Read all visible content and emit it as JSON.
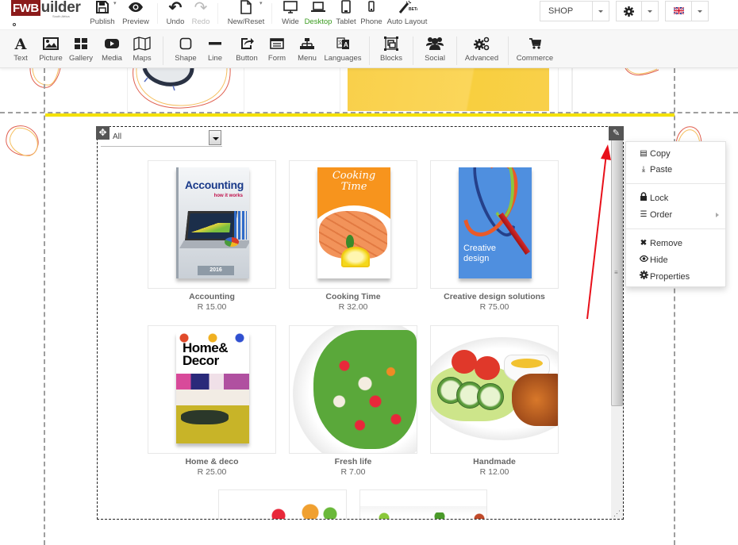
{
  "app": {
    "logo_brand": "FWB",
    "logo_rest": "uilder",
    "logo_sub": "South Africa"
  },
  "top_toolbar": {
    "buttons": [
      {
        "label": "Publish",
        "icon": "floppy-disk-icon"
      },
      {
        "label": "Preview",
        "icon": "eye-icon"
      },
      {
        "label": "Undo",
        "icon": "undo-icon"
      },
      {
        "label": "Redo",
        "icon": "redo-icon",
        "disabled": true
      },
      {
        "label": "New/Reset",
        "icon": "new-page-icon"
      },
      {
        "label": "Wide",
        "icon": "monitor-icon"
      },
      {
        "label": "Desktop",
        "icon": "laptop-icon",
        "active": true
      },
      {
        "label": "Tablet",
        "icon": "tablet-icon"
      },
      {
        "label": "Phone",
        "icon": "phone-icon"
      },
      {
        "label": "Auto Layout",
        "icon": "magic-wand-icon",
        "badge": "BETA"
      }
    ],
    "page_select": "SHOP",
    "settings_icon": "gear-icon",
    "language_icon": "uk-flag-icon"
  },
  "element_toolbar": {
    "items": [
      {
        "label": "Text",
        "icon": "text-icon"
      },
      {
        "label": "Picture",
        "icon": "picture-icon"
      },
      {
        "label": "Gallery",
        "icon": "gallery-icon"
      },
      {
        "label": "Media",
        "icon": "media-icon"
      },
      {
        "label": "Maps",
        "icon": "map-icon"
      },
      {
        "label": "Shape",
        "icon": "shape-icon"
      },
      {
        "label": "Line",
        "icon": "line-icon"
      },
      {
        "label": "Button",
        "icon": "button-icon"
      },
      {
        "label": "Form",
        "icon": "form-icon"
      },
      {
        "label": "Menu",
        "icon": "sitemap-icon"
      },
      {
        "label": "Languages",
        "icon": "languages-icon"
      },
      {
        "label": "Blocks",
        "icon": "blocks-icon"
      },
      {
        "label": "Social",
        "icon": "users-icon"
      },
      {
        "label": "Advanced",
        "icon": "cogs-icon"
      },
      {
        "label": "Commerce",
        "icon": "cart-icon"
      }
    ]
  },
  "widget": {
    "filter_value": "All",
    "products": [
      {
        "name": "Accounting",
        "price": "R 15.00",
        "cover_title": "Accounting",
        "cover_subtitle": "how it works",
        "cover_year": "2016"
      },
      {
        "name": "Cooking Time",
        "price": "R 32.00",
        "cover_title": "Cooking Time"
      },
      {
        "name": "Creative design solutions",
        "price": "R 75.00",
        "cover_title": "Creative design"
      },
      {
        "name": "Home & deco",
        "price": "R 25.00",
        "cover_title": "Home& Decor"
      },
      {
        "name": "Fresh life",
        "price": "R 7.00"
      },
      {
        "name": "Handmade",
        "price": "R 12.00"
      }
    ]
  },
  "context_menu": {
    "items": [
      {
        "label": "Copy",
        "icon": "copy-icon"
      },
      {
        "label": "Paste",
        "icon": "paste-icon"
      },
      {
        "label": "Lock",
        "icon": "lock-icon"
      },
      {
        "label": "Order",
        "icon": "order-list-icon",
        "submenu": true
      },
      {
        "label": "Remove",
        "icon": "remove-icon"
      },
      {
        "label": "Hide",
        "icon": "eye-icon"
      },
      {
        "label": "Properties",
        "icon": "gear-icon"
      }
    ]
  },
  "colors": {
    "brand": "#8b1a1a",
    "active_view": "#3a9b1f",
    "highlight_line": "#f4e100",
    "annotation_arrow": "#e8101a"
  }
}
